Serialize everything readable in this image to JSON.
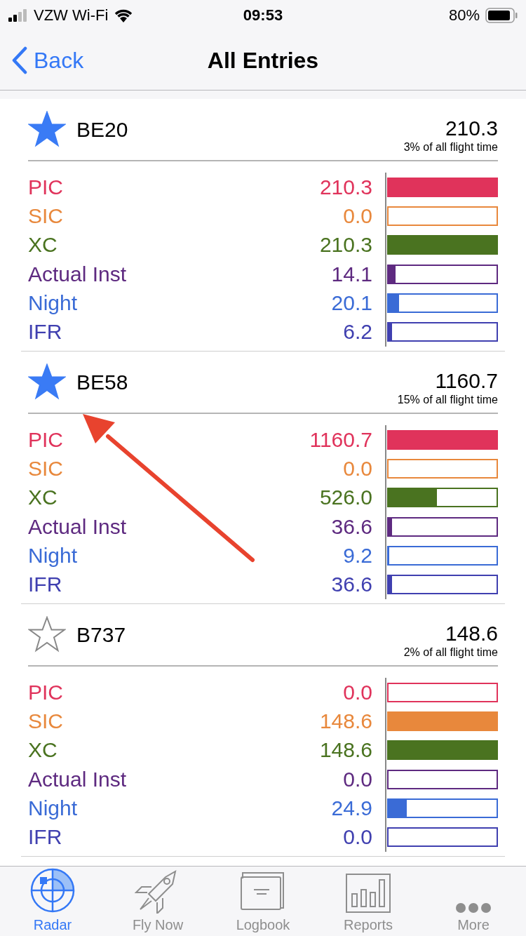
{
  "status_bar": {
    "carrier": "VZW Wi-Fi",
    "time": "09:53",
    "battery": "80%"
  },
  "nav": {
    "back": "Back",
    "title": "All Entries"
  },
  "entries": [
    {
      "name": "BE20",
      "favorite": true,
      "total": "210.3",
      "share": "3% of all flight time",
      "rows": [
        {
          "label": "PIC",
          "value": "210.3",
          "level": 1,
          "color": "#e0335b"
        },
        {
          "label": "SIC",
          "value": "0.0",
          "color": "#e8883c"
        },
        {
          "label": "XC",
          "value": "210.3",
          "level": 1,
          "color": "#4a7320"
        },
        {
          "label": "Actual Inst",
          "value": "14.1",
          "level": 0.067,
          "color": "#5e2a80"
        },
        {
          "label": "Night",
          "value": "20.1",
          "level": 0.096,
          "color": "#3a6bd6"
        },
        {
          "label": "IFR",
          "value": "6.2",
          "level": 0.03,
          "color": "#4040b0"
        }
      ]
    },
    {
      "name": "BE58",
      "favorite": true,
      "total": "1160.7",
      "share": "15% of all flight time",
      "rows": [
        {
          "label": "PIC",
          "value": "1160.7",
          "level": 1,
          "color": "#e0335b"
        },
        {
          "label": "SIC",
          "value": "0.0",
          "color": "#e8883c"
        },
        {
          "label": "XC",
          "value": "526.0",
          "level": 0.45,
          "color": "#4a7320"
        },
        {
          "label": "Actual Inst",
          "value": "36.6",
          "level": 0.032,
          "color": "#5e2a80"
        },
        {
          "label": "Night",
          "value": "9.2",
          "level": 0.008,
          "color": "#3a6bd6"
        },
        {
          "label": "IFR",
          "value": "36.6",
          "level": 0.032,
          "color": "#4040b0"
        }
      ]
    },
    {
      "name": "B737",
      "favorite": false,
      "total": "148.6",
      "share": "2% of all flight time",
      "rows": [
        {
          "label": "PIC",
          "value": "0.0",
          "color": "#e0335b"
        },
        {
          "label": "SIC",
          "value": "148.6",
          "level": 1,
          "color": "#e8883c"
        },
        {
          "label": "XC",
          "value": "148.6",
          "level": 1,
          "color": "#4a7320"
        },
        {
          "label": "Actual Inst",
          "value": "0.0",
          "color": "#5e2a80"
        },
        {
          "label": "Night",
          "value": "24.9",
          "level": 0.168,
          "color": "#3a6bd6"
        },
        {
          "label": "IFR",
          "value": "0.0",
          "color": "#4040b0"
        }
      ]
    }
  ],
  "tabs": [
    {
      "label": "Radar",
      "kind": "radar",
      "selected": true
    },
    {
      "label": "Fly Now",
      "kind": "rocket",
      "selected": false
    },
    {
      "label": "Logbook",
      "kind": "logbook",
      "selected": false
    },
    {
      "label": "Reports",
      "kind": "reports",
      "selected": false
    },
    {
      "label": "More",
      "kind": "more",
      "selected": false
    }
  ]
}
